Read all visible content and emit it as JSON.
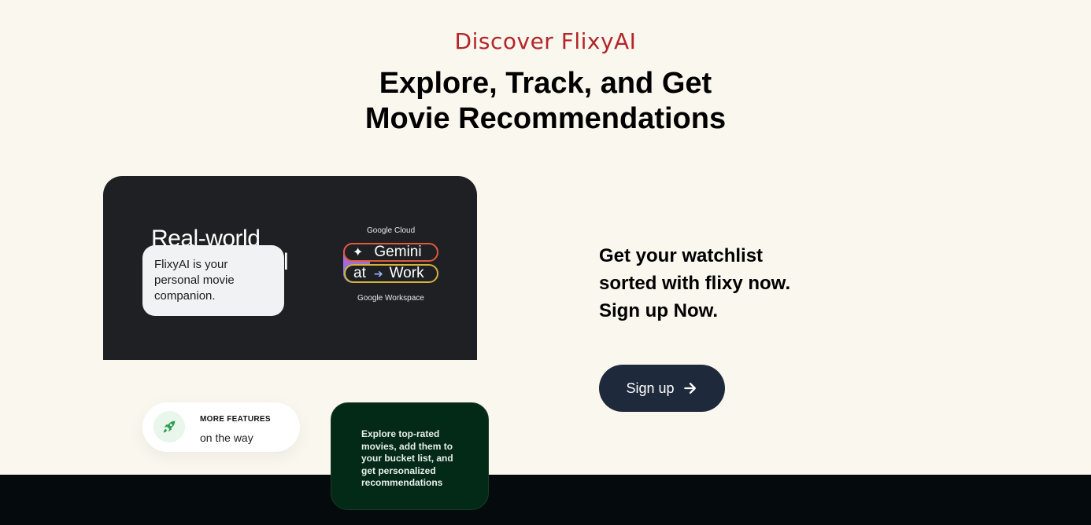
{
  "hero": {
    "eyebrow": "Discover FlixyAI",
    "title_line1": "Explore, Track, and Get",
    "title_line2": "Movie Recommendations"
  },
  "video_card": {
    "headline": "Real-world",
    "headline_cont": "l",
    "google_cloud": "Google Cloud",
    "gemini": "Gemini",
    "at": "at",
    "work": "Work",
    "google_workspace": "Google Workspace"
  },
  "chat_bubble": {
    "text": "FlixyAI is your personal movie companion."
  },
  "features_badge": {
    "icon": "rocket-icon",
    "title": "MORE FEATURES",
    "subtitle": "on the way"
  },
  "explore_card": {
    "text": "Explore top-rated movies, add them to your bucket list, and get personalized recommendations"
  },
  "cta": {
    "line1": "Get your watchlist",
    "line2": "sorted with flixy now.",
    "line3": "Sign up Now.",
    "button_label": "Sign up"
  },
  "colors": {
    "background": "#faf7ee",
    "eyebrow": "#b3262a",
    "button": "#1e293b",
    "explore_card": "#022a17",
    "footer": "#050b0c"
  }
}
